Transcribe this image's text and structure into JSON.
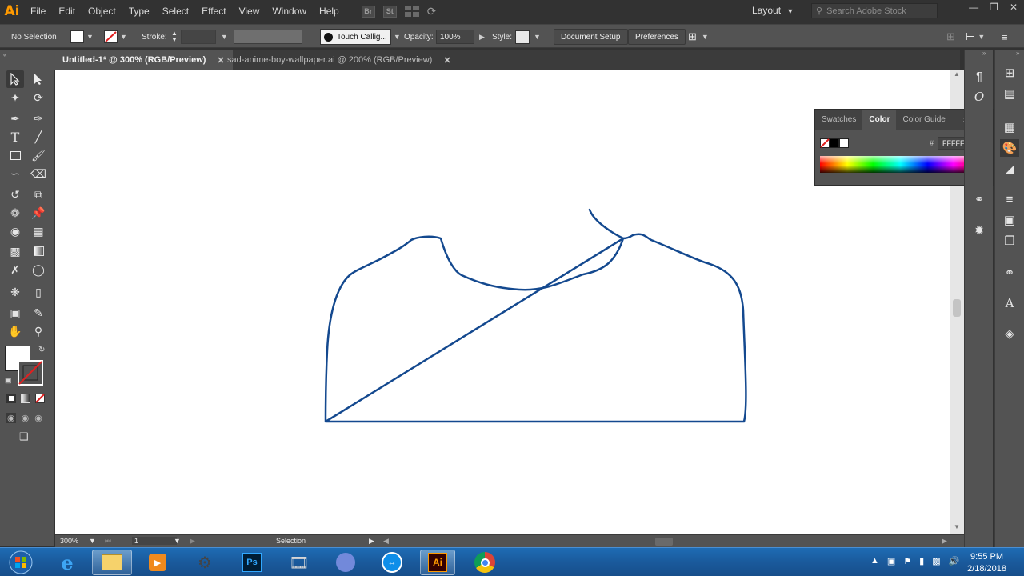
{
  "app": {
    "logo": "Ai",
    "menu": [
      "File",
      "Edit",
      "Object",
      "Type",
      "Select",
      "Effect",
      "View",
      "Window",
      "Help"
    ],
    "menu_icons": [
      "Br",
      "St"
    ],
    "workspace": "Layout",
    "search_placeholder": "Search Adobe Stock"
  },
  "controlbar": {
    "selection": "No Selection",
    "stroke_label": "Stroke:",
    "brush": "Touch Callig...",
    "opacity_label": "Opacity:",
    "opacity_value": "100%",
    "style_label": "Style:",
    "document_setup": "Document Setup",
    "preferences": "Preferences"
  },
  "tabs": [
    {
      "label": "Untitled-1* @ 300% (RGB/Preview)",
      "active": true
    },
    {
      "label": "sad-anime-boy-wallpaper.ai @ 200% (RGB/Preview)",
      "active": false
    }
  ],
  "color_panel": {
    "tabs": [
      "Swatches",
      "Color",
      "Color Guide"
    ],
    "active_tab": "Color",
    "hex_label": "#",
    "hex_value": "FFFFFF"
  },
  "status": {
    "zoom": "300%",
    "artboard": "1",
    "tool": "Selection"
  },
  "taskbar": {
    "time": "9:55 PM",
    "date": "2/18/2018",
    "apps": [
      "start",
      "internet-explorer",
      "file-explorer",
      "media-player",
      "game",
      "photoshop",
      "video",
      "discord",
      "teamviewer",
      "illustrator",
      "chrome"
    ]
  },
  "colors": {
    "accent": "#ff9a00",
    "stroke_path": "#14498f",
    "canvas": "#ffffff",
    "panel": "#535353"
  }
}
